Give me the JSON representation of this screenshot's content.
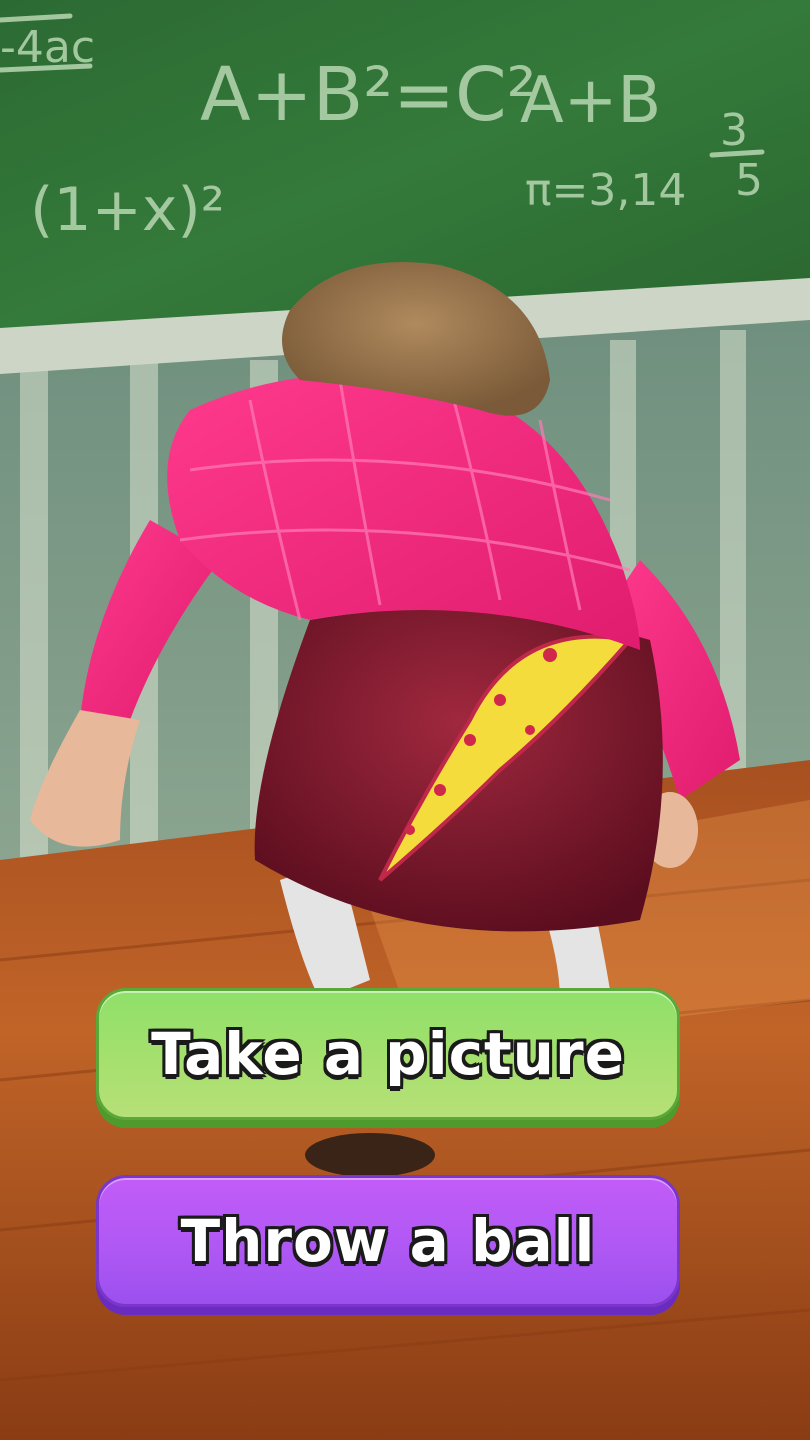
{
  "scene": {
    "description_icon": "teacher-character",
    "chalkboard_formulas": [
      "-4ac",
      "A+B²=C²",
      "A+B",
      "(1+x)²",
      "π=3,14",
      "3/5"
    ]
  },
  "buttons": {
    "take_picture": "Take a picture",
    "throw_ball": "Throw a ball"
  },
  "colors": {
    "green_button": "#a6e06e",
    "purple_button": "#b058f4",
    "chalkboard": "#2f6b34",
    "floor": "#b5561e"
  }
}
